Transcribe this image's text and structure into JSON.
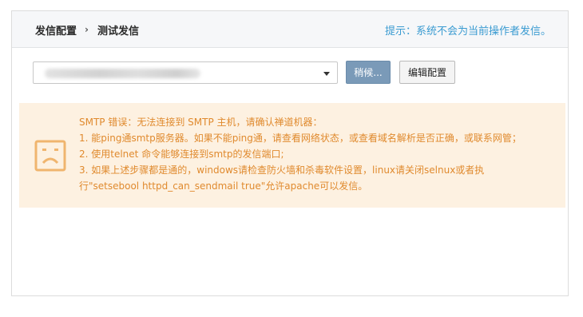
{
  "header": {
    "breadcrumb": [
      "发信配置",
      "测试发信"
    ],
    "separator": "›",
    "hint": "提示：系统不会为当前操作者发信。"
  },
  "toolbar": {
    "recipient_select": {
      "value": ""
    },
    "wait_button_label": "稍候...",
    "edit_config_label": "编辑配置"
  },
  "alert": {
    "icon": "sad-face-icon",
    "lines": [
      "SMTP 错误：无法连接到 SMTP 主机，请确认禅道机器：",
      "1. 能ping通smtp服务器。如果不能ping通，请查看网络状态，或查看域名解析是否正确，或联系网管；",
      "2. 使用telnet 命令能够连接到smtp的发信端口;",
      "3. 如果上述步骤都是通的，windows请检查防火墙和杀毒软件设置，linux请关闭selnux或者执",
      "行\"setsebool httpd_can_sendmail true\"允许apache可以发信。"
    ]
  },
  "colors": {
    "hint": "#3a9bd1",
    "alert_text": "#e08a2e",
    "alert_bg": "#fdf1e1",
    "wait_button_bg": "#7a9ab8"
  }
}
